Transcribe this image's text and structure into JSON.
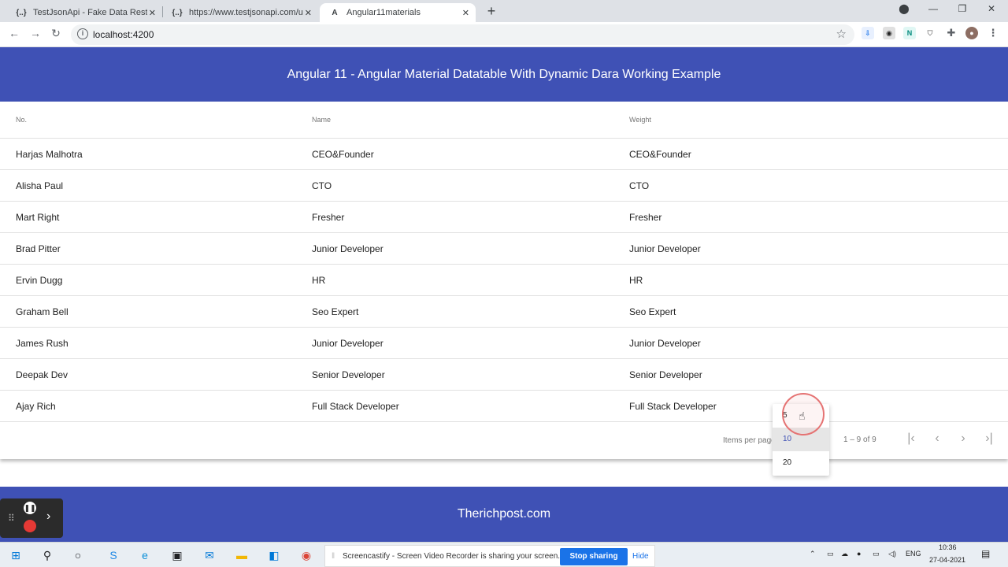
{
  "browser": {
    "tabs": [
      {
        "title": "TestJsonApi - Fake Data Rest API",
        "favicon": "{..}"
      },
      {
        "title": "https://www.testjsonapi.com/use",
        "favicon": "{..}"
      },
      {
        "title": "Angular11materials",
        "favicon": "A"
      }
    ],
    "url": "localhost:4200"
  },
  "page": {
    "title": "Angular 11 - Angular Material Datatable With Dynamic Dara Working Example",
    "footer": "Therichpost.com"
  },
  "table": {
    "headers": [
      "No.",
      "Name",
      "Weight"
    ],
    "rows": [
      [
        "Harjas Malhotra",
        "CEO&Founder",
        "CEO&Founder"
      ],
      [
        "Alisha Paul",
        "CTO",
        "CTO"
      ],
      [
        "Mart Right",
        "Fresher",
        "Fresher"
      ],
      [
        "Brad Pitter",
        "Junior Developer",
        "Junior Developer"
      ],
      [
        "Ervin Dugg",
        "HR",
        "HR"
      ],
      [
        "Graham Bell",
        "Seo Expert",
        "Seo Expert"
      ],
      [
        "James Rush",
        "Junior Developer",
        "Junior Developer"
      ],
      [
        "Deepak Dev",
        "Senior Developer",
        "Senior Developer"
      ],
      [
        "Ajay Rich",
        "Full Stack Developer",
        "Full Stack Developer"
      ]
    ]
  },
  "paginator": {
    "items_per_page_label": "Items per page",
    "range": "1 – 9 of 9",
    "options": [
      "5",
      "10",
      "20"
    ],
    "selected": "10"
  },
  "screen_share": {
    "message": "Screencastify - Screen Video Recorder is sharing your screen.",
    "stop": "Stop sharing",
    "hide": "Hide"
  },
  "system": {
    "lang": "ENG",
    "time": "10:36",
    "date": "27-04-2021"
  },
  "colors": {
    "primary": "#3f51b5",
    "stop_button": "#1a73e8"
  }
}
